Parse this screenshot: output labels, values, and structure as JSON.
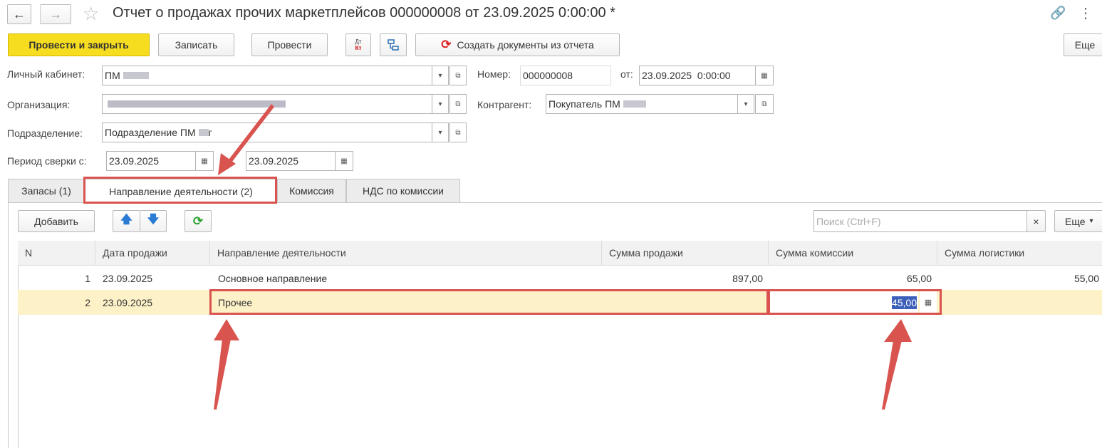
{
  "window": {
    "title": "Отчет о продажах прочих маркетплейсов 000000008 от 23.09.2025 0:00:00 *",
    "more_icon": "⋮"
  },
  "toolbar": {
    "post_close": "Провести и закрыть",
    "save": "Записать",
    "post": "Провести",
    "dt_kt_top": "Дт",
    "dt_kt_bottom": "Кт",
    "create_docs": "Создать документы из отчета",
    "more": "Еще"
  },
  "header": {
    "cabinet_label": "Личный кабинет:",
    "cabinet_value": "ПМ ",
    "number_label": "Номер:",
    "number_value": "000000008",
    "date_label": "от:",
    "date_value": "23.09.2025  0:00:00",
    "org_label": "Организация:",
    "counterparty_label": "Контрагент:",
    "counterparty_value": "Покупатель ПМ ",
    "division_label": "Подразделение:",
    "division_value": "Подразделение ПМ ",
    "division_suffix": "г",
    "period_label": "Период сверки с:",
    "period_from": "23.09.2025",
    "period_to": "23.09.2025"
  },
  "tabs": [
    {
      "label": "Запасы (1)"
    },
    {
      "label": "Направление деятельности (2)"
    },
    {
      "label": "Комиссия"
    },
    {
      "label": "НДС по комиссии"
    }
  ],
  "table_toolbar": {
    "add": "Добавить",
    "search_placeholder": "Поиск (Ctrl+F)",
    "clear": "×",
    "more": "Еще"
  },
  "table": {
    "columns": [
      "N",
      "Дата продажи",
      "Направление деятельности",
      "Сумма продажи",
      "Сумма комиссии",
      "Сумма логистики"
    ],
    "rows": [
      {
        "n": "1",
        "date": "23.09.2025",
        "direction": "Основное направление",
        "sales": "897,00",
        "commission": "65,00",
        "logistics": "55,00"
      },
      {
        "n": "2",
        "date": "23.09.2025",
        "direction": "Прочее",
        "sales": "",
        "commission": "45,00",
        "logistics": ""
      }
    ]
  },
  "colors": {
    "accent_yellow": "#f7dd20",
    "selected_row": "#fdf1c8",
    "annotation_red": "#d9534f",
    "selection_blue": "#3c5fb9"
  }
}
